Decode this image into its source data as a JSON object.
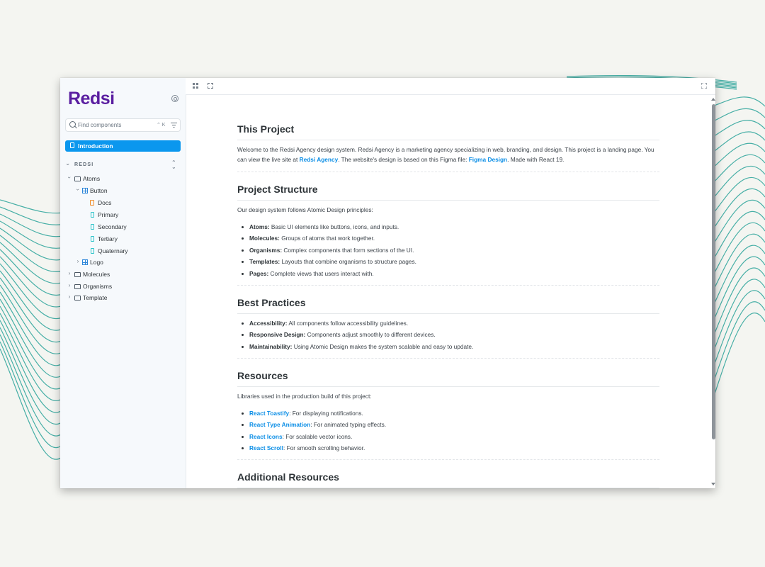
{
  "app": {
    "logo_text": "Redsi",
    "accent": "#0b97ee",
    "brand": "#5a1ea0"
  },
  "search": {
    "placeholder": "Find components",
    "shortcut": "⌃ K"
  },
  "sidebar": {
    "active_item": "Introduction",
    "section_label": "REDSI",
    "tree": {
      "atoms": "Atoms",
      "button": "Button",
      "docs": "Docs",
      "primary": "Primary",
      "secondary": "Secondary",
      "tertiary": "Tertiary",
      "quaternary": "Quaternary",
      "logo": "Logo",
      "molecules": "Molecules",
      "organisms": "Organisms",
      "template": "Template"
    }
  },
  "doc": {
    "s1": {
      "title": "This Project",
      "p1": "Welcome to the Redsi Agency design system. Redsi Agency is a marketing agency specializing in web, branding, and design. This project is a landing page. You can view the live site at ",
      "link1": "Redsi Agency",
      "p2": ". The website's design is based on this Figma file: ",
      "link2": "Figma Design",
      "p3": ". Made with React 19."
    },
    "s2": {
      "title": "Project Structure",
      "intro": "Our design system follows Atomic Design principles:",
      "items": [
        {
          "term": "Atoms:",
          "desc": " Basic UI elements like buttons, icons, and inputs."
        },
        {
          "term": "Molecules:",
          "desc": " Groups of atoms that work together."
        },
        {
          "term": "Organisms:",
          "desc": " Complex components that form sections of the UI."
        },
        {
          "term": "Templates:",
          "desc": " Layouts that combine organisms to structure pages."
        },
        {
          "term": "Pages:",
          "desc": " Complete views that users interact with."
        }
      ]
    },
    "s3": {
      "title": "Best Practices",
      "items": [
        {
          "term": "Accessibility:",
          "desc": " All components follow accessibility guidelines."
        },
        {
          "term": "Responsive Design:",
          "desc": " Components adjust smoothly to different devices."
        },
        {
          "term": "Maintainability:",
          "desc": " Using Atomic Design makes the system scalable and easy to update."
        }
      ]
    },
    "s4": {
      "title": "Resources",
      "intro": "Libraries used in the production build of this project:",
      "items": [
        {
          "link": "React Toastify",
          "desc": ": For displaying notifications."
        },
        {
          "link": "React Type Animation",
          "desc": ": For animated typing effects."
        },
        {
          "link": "React Icons",
          "desc": ": For scalable vector icons."
        },
        {
          "link": "React Scroll",
          "desc": ": For smooth scrolling behavior."
        }
      ]
    },
    "s5": {
      "title": "Additional Resources"
    }
  }
}
